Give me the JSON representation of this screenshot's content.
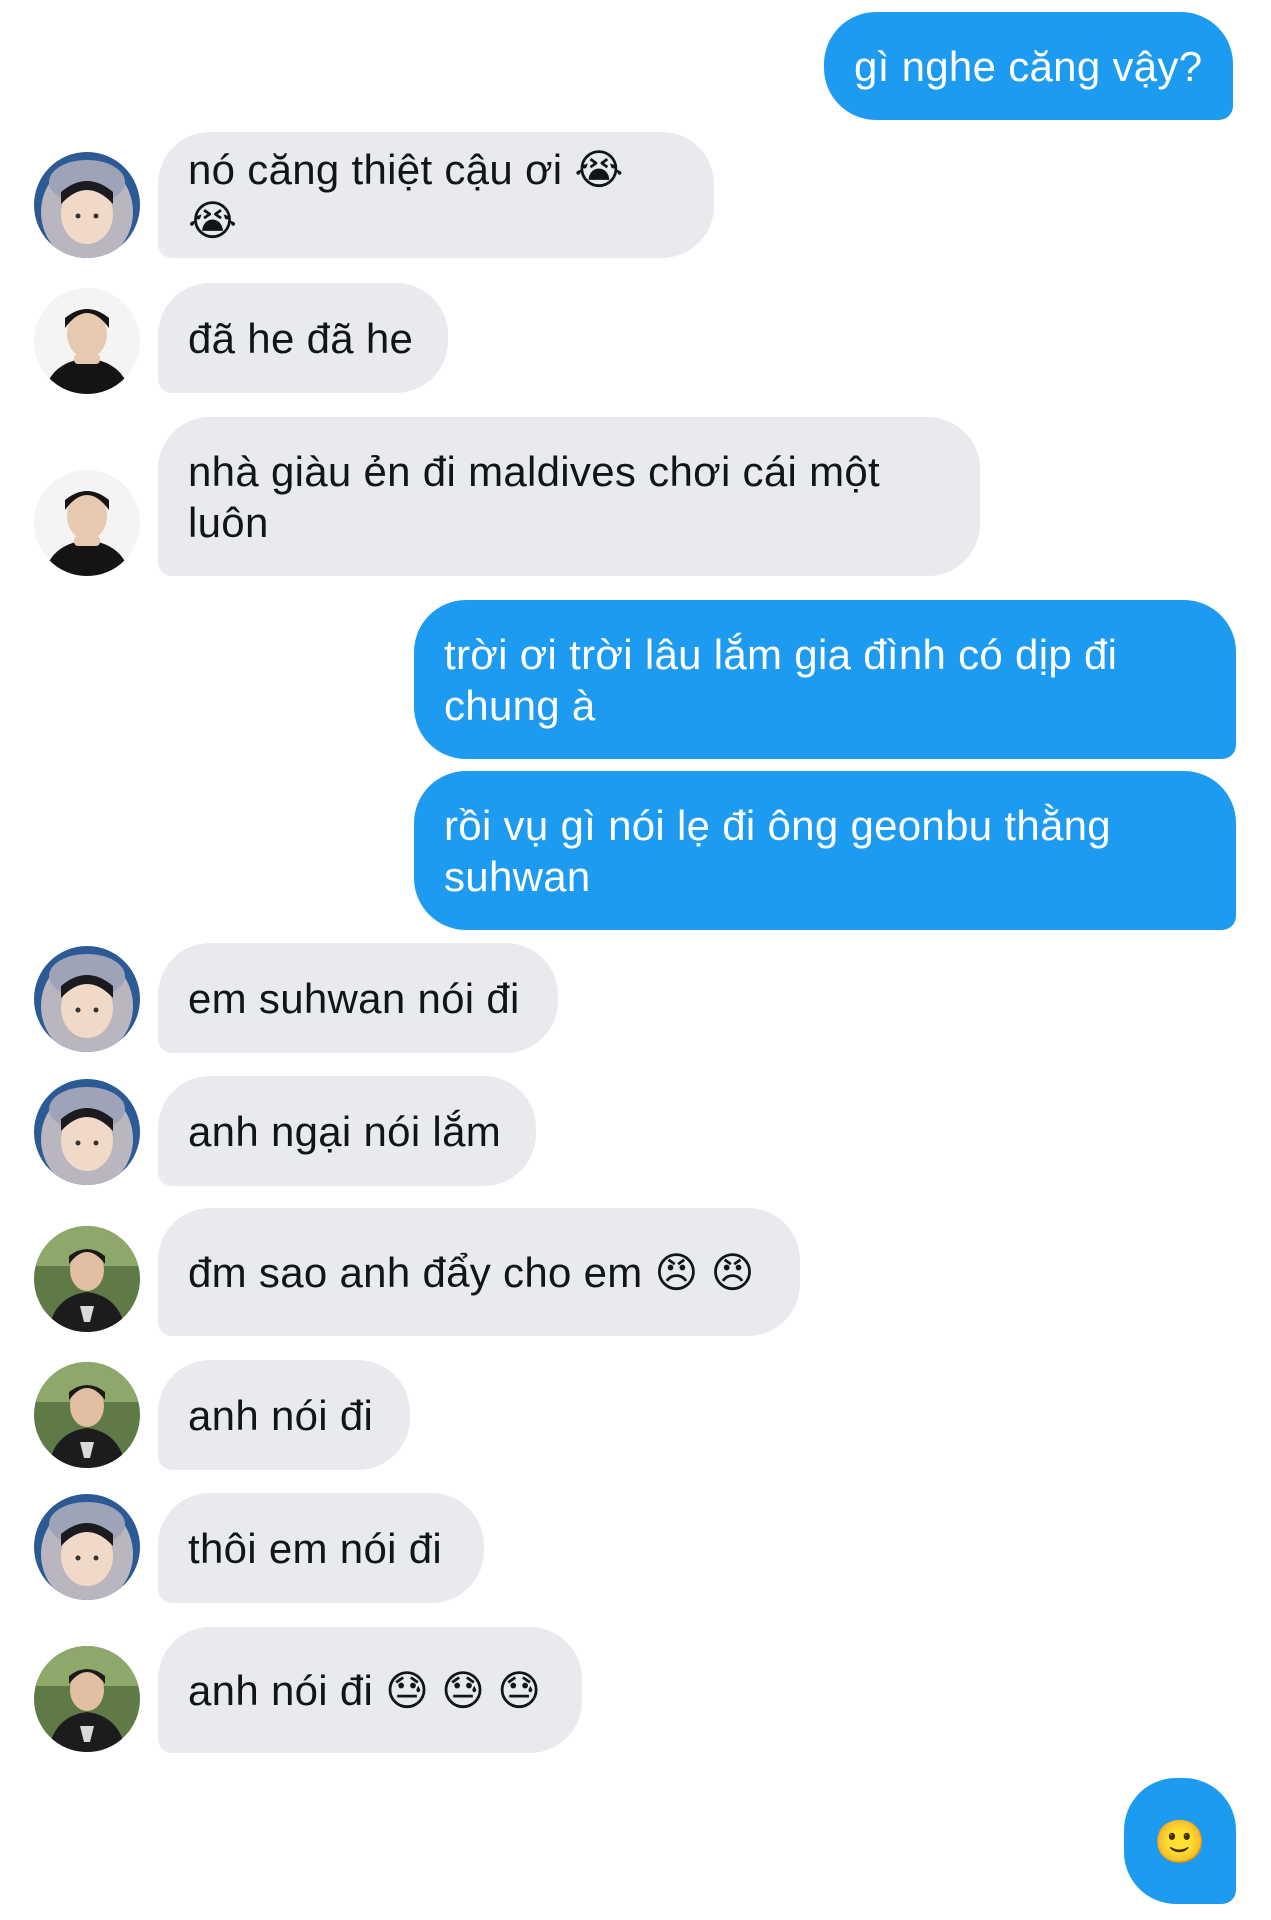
{
  "messages": [
    {
      "side": "out",
      "text": "gì nghe căng vậy?"
    },
    {
      "side": "in",
      "avatar": "hooded-user-avatar",
      "text": "nó căng thiệt cậu ơi 😭 😭"
    },
    {
      "side": "in",
      "avatar": "dark-shirt-user-avatar",
      "text": "đã he đã he"
    },
    {
      "side": "in",
      "avatar": "dark-shirt-user-avatar",
      "text": "nhà giàu ẻn đi maldives chơi cái một luôn"
    },
    {
      "side": "out",
      "text": "trời ơi trời lâu lắm gia đình có dịp đi chung à"
    },
    {
      "side": "out",
      "text": "rồi vụ gì nói lẹ đi ông geonbu thằng suhwan"
    },
    {
      "side": "in",
      "avatar": "hooded-user-avatar",
      "text": "em suhwan nói đi"
    },
    {
      "side": "in",
      "avatar": "hooded-user-avatar",
      "text": "anh ngại nói lắm"
    },
    {
      "side": "in",
      "avatar": "jersey-user-avatar",
      "text": "đm sao anh đẩy cho em 😠 😠"
    },
    {
      "side": "in",
      "avatar": "jersey-user-avatar",
      "text": "anh nói đi"
    },
    {
      "side": "in",
      "avatar": "hooded-user-avatar",
      "text": "thôi em nói đi"
    },
    {
      "side": "in",
      "avatar": "jersey-user-avatar",
      "text": "anh nói đi 😓 😓 😓"
    },
    {
      "side": "out",
      "text": "🙂"
    }
  ],
  "colors": {
    "outgoing_bubble": "#1d9bf0",
    "incoming_bubble": "#e9eaee",
    "outgoing_text": "#ffffff",
    "incoming_text": "#111418",
    "background": "#ffffff"
  }
}
